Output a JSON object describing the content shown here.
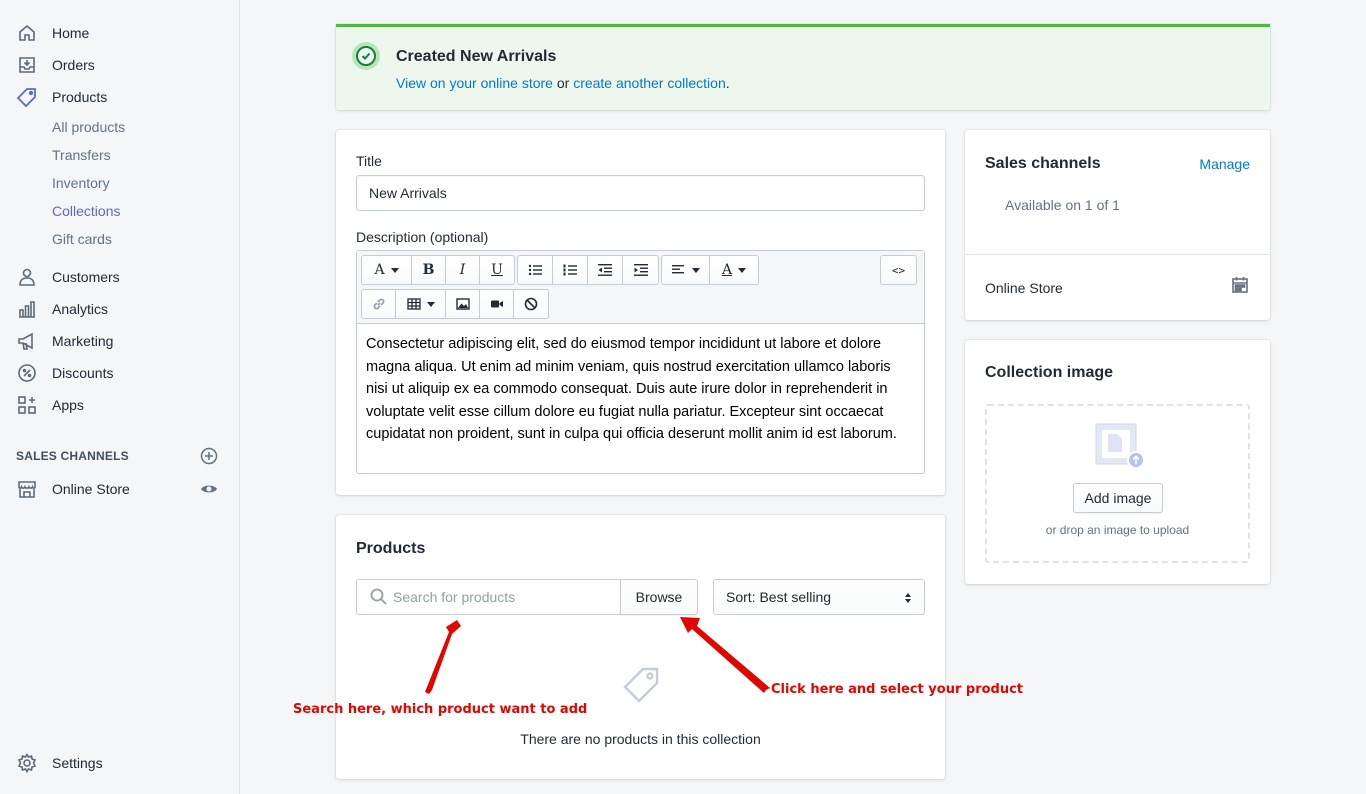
{
  "sidebar": {
    "items": [
      {
        "label": "Home",
        "icon": "home-icon"
      },
      {
        "label": "Orders",
        "icon": "orders-icon"
      },
      {
        "label": "Products",
        "icon": "tag-icon"
      },
      {
        "label": "Customers",
        "icon": "person-icon"
      },
      {
        "label": "Analytics",
        "icon": "bar-chart-icon"
      },
      {
        "label": "Marketing",
        "icon": "megaphone-icon"
      },
      {
        "label": "Discounts",
        "icon": "discount-icon"
      },
      {
        "label": "Apps",
        "icon": "apps-icon"
      }
    ],
    "product_subitems": [
      "All products",
      "Transfers",
      "Inventory",
      "Collections",
      "Gift cards"
    ],
    "active_subitem": "Collections",
    "sales_channels_label": "SALES CHANNELS",
    "online_store": "Online Store",
    "settings": "Settings"
  },
  "banner": {
    "title": "Created New Arrivals",
    "link1": "View on your online store",
    "connector": " or ",
    "link2": "create another collection",
    "end": "."
  },
  "details": {
    "title_label": "Title",
    "title_value": "New Arrivals",
    "description_label": "Description (optional)",
    "description": "Consectetur adipiscing elit, sed do eiusmod tempor incididunt ut labore et dolore magna aliqua. Ut enim ad minim veniam, quis nostrud exercitation ullamco laboris nisi ut aliquip ex ea commodo consequat. Duis aute irure dolor in reprehenderit in voluptate velit esse cillum dolore eu fugiat nulla pariatur. Excepteur sint occaecat cupidatat non proident, sunt in culpa qui officia deserunt mollit anim id est laborum.",
    "toolbar": {
      "font": "A",
      "bold": "B",
      "italic": "I",
      "underline": "U",
      "text_color": "A",
      "html": "<>"
    }
  },
  "products": {
    "title": "Products",
    "search_placeholder": "Search for products",
    "browse": "Browse",
    "sort": "Sort: Best selling",
    "empty": "There are no products in this collection"
  },
  "sales_channels": {
    "title": "Sales channels",
    "manage": "Manage",
    "available": "Available on 1 of 1",
    "online_store": "Online Store"
  },
  "collection_image": {
    "title": "Collection image",
    "add_image": "Add image",
    "drop_text": "or drop an image to upload"
  },
  "annotations": {
    "search_note": "Search here, which product want to add",
    "browse_note": "Click here and select your product"
  },
  "colors": {
    "accent": "#5c6ac4",
    "link": "#007ace",
    "success": "#50b83c",
    "annotation": "#e10600"
  }
}
